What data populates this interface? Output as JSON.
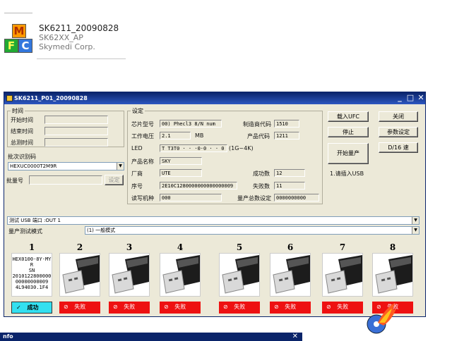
{
  "app": {
    "title": "SK6211_20090828",
    "subtitle": "SK62XX_AP",
    "company": "Skymedi Corp.",
    "logo_letters": [
      "M",
      "F",
      "C"
    ]
  },
  "window": {
    "title": "SK6211_P01_20090828",
    "min": "_",
    "max": "□",
    "close": "✕"
  },
  "left_group": {
    "title": "时间",
    "rows": [
      "开始时间",
      "结束时间",
      "总测时间"
    ],
    "device_label": "批次识别码",
    "device_value": "HEXUC0000T2M9R",
    "serial_label": "批量号",
    "serial_button": "设定"
  },
  "settings": {
    "title": "设定",
    "left_rows": [
      {
        "label": "芯片型号",
        "value": "00) Phecl3 8/N num"
      },
      {
        "label": "工作电压",
        "value": "2.1",
        "unit": "MB"
      },
      {
        "label": "LED",
        "value": "T T3T0 · · ·0·0 · · 0 0(0)",
        "suffix": "(1G~4K)"
      },
      {
        "label": "产品名称",
        "value": "SKY"
      },
      {
        "label": "厂商",
        "value": "UTE"
      },
      {
        "label": "序号",
        "value": "2E10C1280000000000000009"
      },
      {
        "label": "读写机种",
        "value": "000"
      }
    ],
    "right_rows": [
      {
        "label": "制造商代码",
        "value": "1510"
      },
      {
        "label": "产品代码",
        "value": "1211"
      },
      {
        "label": "成功数",
        "value": "12"
      },
      {
        "label": "失败数",
        "value": "11"
      },
      {
        "label": "量产总数设定",
        "value": "0000000000"
      }
    ]
  },
  "buttons": {
    "load": "载入UFC",
    "stop": "停止",
    "start": "开始量产",
    "status": "1.请插入USB",
    "exit": "关闭",
    "params": "参数设定",
    "quick": "D/16 速"
  },
  "combos": {
    "hub": "测试 USB 端口 :OUT 1",
    "mode_label": "量产测试模式",
    "mode": "(1) 一般模式"
  },
  "ports": [
    {
      "num": "1",
      "info": "HEX0100·8Y·MY\nR\nSN\n2010122800000\n00000000009\n4L94030.1F4",
      "status": "成功",
      "ok": true
    },
    {
      "num": "2",
      "status": "失败",
      "ok": false
    },
    {
      "num": "3",
      "status": "失败",
      "ok": false
    },
    {
      "num": "4",
      "status": "失败",
      "ok": false
    },
    {
      "num": "5",
      "status": "失败",
      "ok": false
    },
    {
      "num": "6",
      "status": "失败",
      "ok": false
    },
    {
      "num": "7",
      "status": "失败",
      "ok": false
    },
    {
      "num": "8",
      "status": "失败",
      "ok": false
    }
  ],
  "bottom": {
    "title": "nfo",
    "close": "✕"
  },
  "colors": {
    "title_bar": "#0a246a",
    "fail": "#ee1111",
    "ok": "#33e0f0"
  }
}
